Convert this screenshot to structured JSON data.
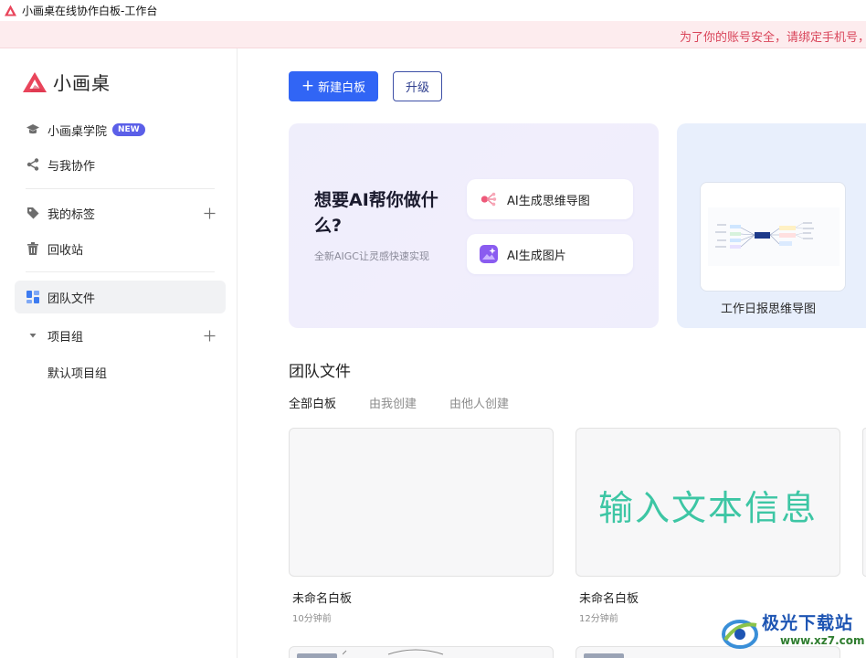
{
  "window": {
    "title": "小画桌在线协作白板-工作台"
  },
  "banner": {
    "text": "为了你的账号安全，请绑定手机号，"
  },
  "brand": {
    "name": "小画桌",
    "color": "#e9455b"
  },
  "sidebar": {
    "items": [
      {
        "label": "小画桌学院",
        "icon": "graduation-cap-icon",
        "badge": "NEW"
      },
      {
        "label": "与我协作",
        "icon": "share-icon"
      },
      {
        "label": "我的标签",
        "icon": "tag-icon"
      },
      {
        "label": "回收站",
        "icon": "trash-icon"
      },
      {
        "label": "团队文件",
        "icon": "team-files-icon",
        "active": true
      },
      {
        "label": "项目组",
        "icon": "caret-down-icon"
      }
    ],
    "project_group_default": "默认项目组"
  },
  "toolbar": {
    "new_label": "新建白板",
    "new_prefix": "+",
    "upgrade_label": "升级"
  },
  "ai_card": {
    "headline": "想要AI帮你做什么?",
    "subtitle": "全新AIGC让灵感快速实现",
    "buttons": [
      {
        "label": "AI生成思维导图",
        "icon": "ai-mindmap-icon"
      },
      {
        "label": "AI生成图片",
        "icon": "ai-image-icon"
      }
    ]
  },
  "template_card": {
    "title": "工作日报思维导图"
  },
  "section": {
    "title": "团队文件"
  },
  "tabs": [
    {
      "label": "全部白板",
      "active": true
    },
    {
      "label": "由我创建"
    },
    {
      "label": "由他人创建"
    }
  ],
  "files": [
    {
      "name": "未命名白板",
      "time": "10分钟前",
      "preview_text": ""
    },
    {
      "name": "未命名白板",
      "time": "12分钟前",
      "preview_text": "输入文本信息"
    }
  ],
  "watermark": {
    "name": "极光下载站",
    "url": "www.xz7.com"
  },
  "colors": {
    "primary": "#3165f5",
    "banner_bg": "#fdecee",
    "banner_text": "#d9455a",
    "preview_text": "#3dc6a4"
  }
}
